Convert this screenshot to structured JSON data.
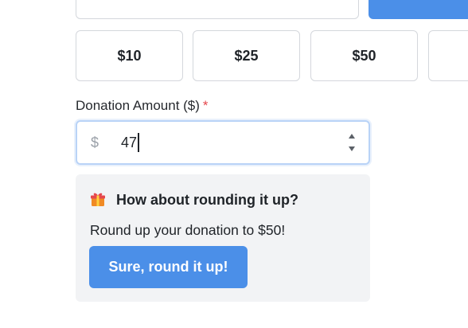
{
  "presets": [
    {
      "label": "$10"
    },
    {
      "label": "$25"
    },
    {
      "label": "$50"
    },
    {
      "label": ""
    }
  ],
  "amount_field": {
    "label": "Donation Amount ($)",
    "required_marker": "*",
    "currency_symbol": "$",
    "value": "47"
  },
  "roundup": {
    "icon": "gift-icon",
    "title": "How about rounding it up?",
    "message": "Round up your donation to $50!",
    "button_label": "Sure, round it up!"
  },
  "colors": {
    "accent": "#4b8fe8",
    "required": "#e5484d",
    "card_background": "#f2f3f5"
  }
}
